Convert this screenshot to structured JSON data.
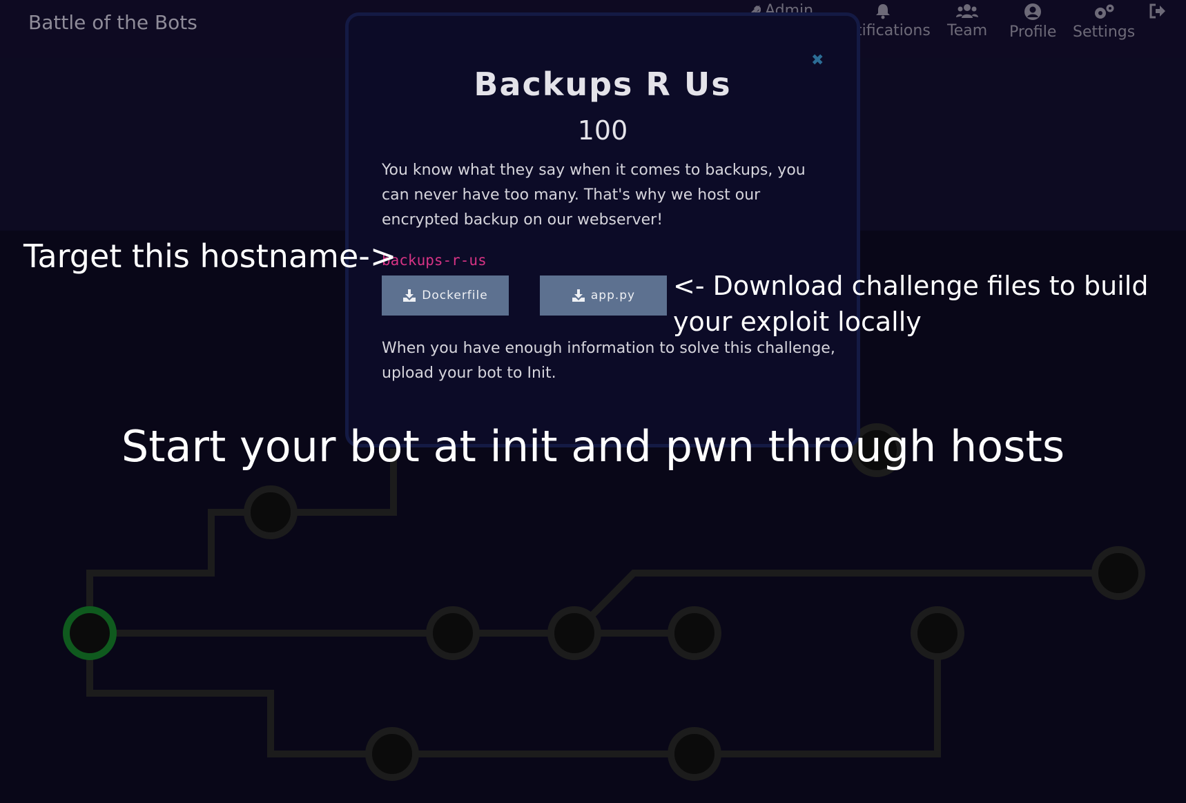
{
  "navbar": {
    "brand": "Battle of the Bots",
    "admin_label": "Admin",
    "notifications_label": "tifications",
    "team_label": "Team",
    "profile_label": "Profile",
    "settings_label": "Settings"
  },
  "modal": {
    "close_glyph": "✖",
    "title": "Backups R Us",
    "points": "100",
    "description": "You know what they say when it comes to backups, you can never have too many. That's why we host our encrypted backup on our webserver!",
    "hostname": "backups-r-us",
    "files": [
      "Dockerfile",
      "app.py"
    ],
    "footer": "When you have enough information to solve this challenge, upload your bot to Init."
  },
  "annotations": {
    "hostname_hint": "Target this hostname->",
    "download_hint": "<- Download challenge files to build your exploit locally",
    "start_hint": "Start your bot  at init and pwn through hosts"
  },
  "colors": {
    "background": "#090718",
    "modal": "#0c0b27",
    "hostname": "#d63384",
    "button": "#5d7190",
    "init_node": "#0f5a1e",
    "graph_line": "#1c1c1c"
  },
  "icons": {
    "admin": "wrench-icon",
    "notifications": "bell-icon",
    "team": "users-icon",
    "profile": "user-circle-icon",
    "settings": "gears-icon",
    "logout": "sign-out-icon",
    "download": "download-icon",
    "close": "close-icon"
  }
}
